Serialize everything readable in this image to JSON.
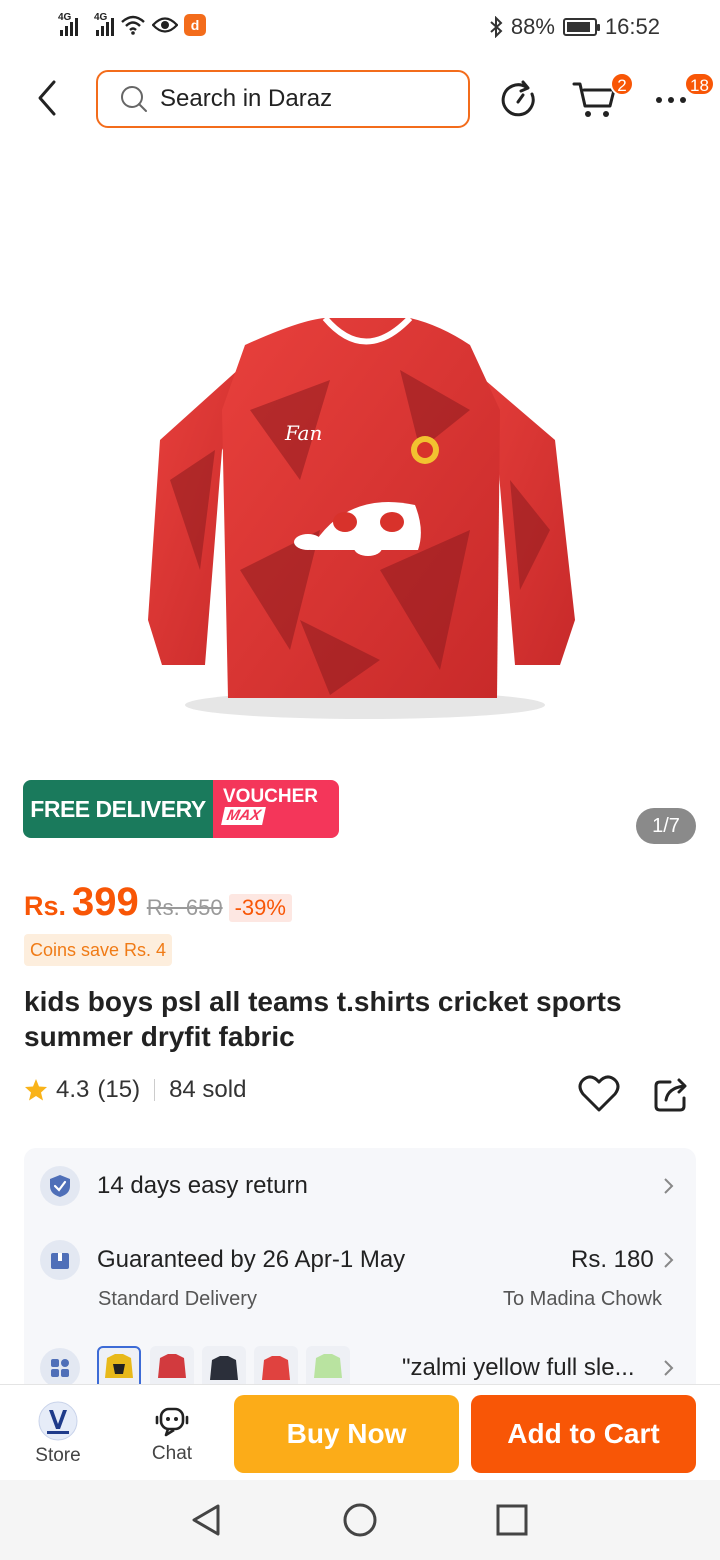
{
  "status_bar": {
    "net1": "4G",
    "net2": "4G",
    "battery": "88%",
    "time": "16:52",
    "icons": [
      "signal-icon",
      "wifi-icon",
      "eye-icon",
      "app-notification-icon",
      "bluetooth-icon",
      "battery-icon"
    ]
  },
  "header": {
    "search_placeholder": "Search in Daraz",
    "cart_count": "2",
    "more_count": "18"
  },
  "gallery": {
    "counter": "1/7",
    "promo_free": "FREE DELIVERY",
    "promo_voucher": "VOUCHER",
    "promo_max": "MAX"
  },
  "product": {
    "currency": "Rs.",
    "price": "399",
    "old_price": "Rs. 650",
    "discount": "-39%",
    "coins": "Coins save Rs. 4",
    "title": "kids boys psl all teams t.shirts cricket sports summer dryfit fabric",
    "rating": "4.3",
    "reviews": "(15)",
    "sold": "84 sold"
  },
  "info": {
    "return_text": "14 days easy return",
    "delivery_text": "Guaranteed by 26 Apr-1 May",
    "delivery_price": "Rs. 180",
    "delivery_type": "Standard Delivery",
    "delivery_location": "To Madina Chowk",
    "variant_text": "\"zalmi yellow full sle..."
  },
  "bottom_bar": {
    "store_label": "Store",
    "chat_label": "Chat",
    "buy_now": "Buy Now",
    "add_to_cart": "Add to Cart"
  },
  "colors": {
    "brand_orange": "#f85606",
    "buy_now_yellow": "#fcac18",
    "promo_green": "#1a7a5c",
    "promo_pink": "#f4365a"
  }
}
